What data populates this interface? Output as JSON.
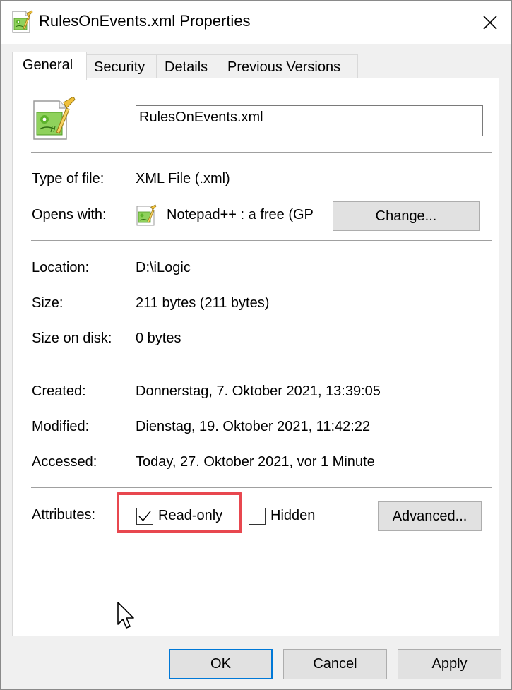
{
  "window": {
    "title": "RulesOnEvents.xml Properties"
  },
  "tabs": [
    {
      "label": "General",
      "active": true
    },
    {
      "label": "Security",
      "active": false
    },
    {
      "label": "Details",
      "active": false
    },
    {
      "label": "Previous Versions",
      "active": false
    }
  ],
  "general": {
    "file_name": "RulesOnEvents.xml",
    "type_label": "Type of file:",
    "type_value": "XML File (.xml)",
    "opens_label": "Opens with:",
    "opens_value": "Notepad++ : a free (GP",
    "change_button": "Change...",
    "location_label": "Location:",
    "location_value": "D:\\iLogic",
    "size_label": "Size:",
    "size_value": "211 bytes (211 bytes)",
    "size_disk_label": "Size on disk:",
    "size_disk_value": "0 bytes",
    "created_label": "Created:",
    "created_value": "Donnerstag, 7. Oktober 2021, 13:39:05",
    "modified_label": "Modified:",
    "modified_value": "Dienstag, 19. Oktober 2021, 11:42:22",
    "accessed_label": "Accessed:",
    "accessed_value": "Today, 27. Oktober 2021, vor 1 Minute",
    "attributes_label": "Attributes:",
    "readonly_label": "Read-only",
    "readonly_checked": true,
    "hidden_label": "Hidden",
    "hidden_checked": false,
    "advanced_button": "Advanced..."
  },
  "buttons": {
    "ok": "OK",
    "cancel": "Cancel",
    "apply": "Apply"
  },
  "colors": {
    "highlight": "#e8474f",
    "default_button_border": "#0078d7"
  },
  "icons": {
    "title": "notepadpp-file-icon",
    "file": "notepadpp-file-icon",
    "opens_with": "notepadpp-app-icon",
    "close": "close-icon",
    "check": "checkmark-icon",
    "cursor": "mouse-pointer-icon"
  }
}
